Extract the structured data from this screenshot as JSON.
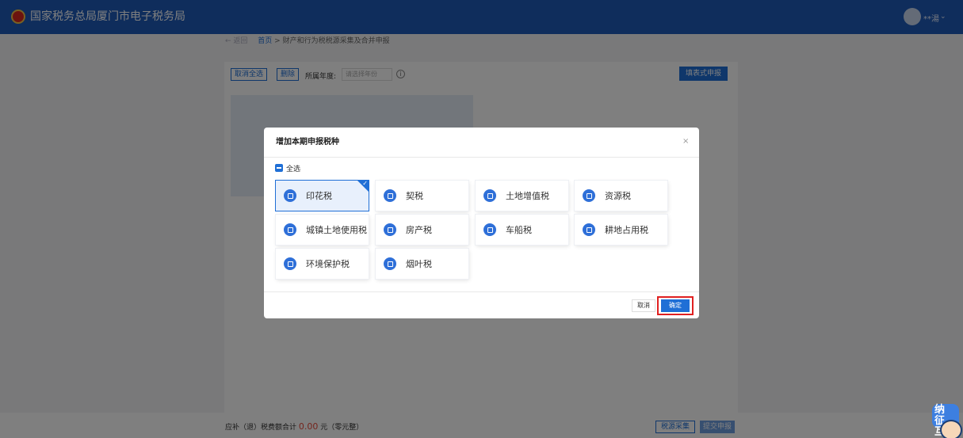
{
  "header": {
    "title": "国家税务总局厦门市电子税务局",
    "user_name": "**湯"
  },
  "breadcrumb": {
    "back": "← 返回",
    "home": "首页",
    "separator": ">",
    "current": "财产和行为税税源采集及合并申报"
  },
  "toolbar": {
    "deselect_all": "取消全选",
    "delete": "删除",
    "year_label": "所属年度:",
    "year_placeholder": "请选择年份",
    "report_button": "填表式申报"
  },
  "footer": {
    "total_prefix": "应补（退）税费额合计",
    "total_amount": "0.00",
    "total_suffix": "元（零元整）",
    "btn_a": "税源采集",
    "btn_b": "提交申报"
  },
  "mascot": {
    "text": "纳 征 互"
  },
  "dialog": {
    "title": "增加本期申报税种",
    "close": "×",
    "select_all": "全选",
    "taxes": [
      {
        "name": "印花税",
        "selected": true
      },
      {
        "name": "契税",
        "selected": false
      },
      {
        "name": "土地增值税",
        "selected": false
      },
      {
        "name": "资源税",
        "selected": false
      },
      {
        "name": "城镇土地使用税",
        "selected": false
      },
      {
        "name": "房产税",
        "selected": false
      },
      {
        "name": "车船税",
        "selected": false
      },
      {
        "name": "耕地占用税",
        "selected": false
      },
      {
        "name": "环境保护税",
        "selected": false
      },
      {
        "name": "烟叶税",
        "selected": false
      }
    ],
    "cancel": "取消",
    "confirm": "确定"
  },
  "colors": {
    "primary": "#1f6fd6",
    "header": "#1f5bb9",
    "highlight": "#e02020",
    "amount": "#e94b3c"
  }
}
